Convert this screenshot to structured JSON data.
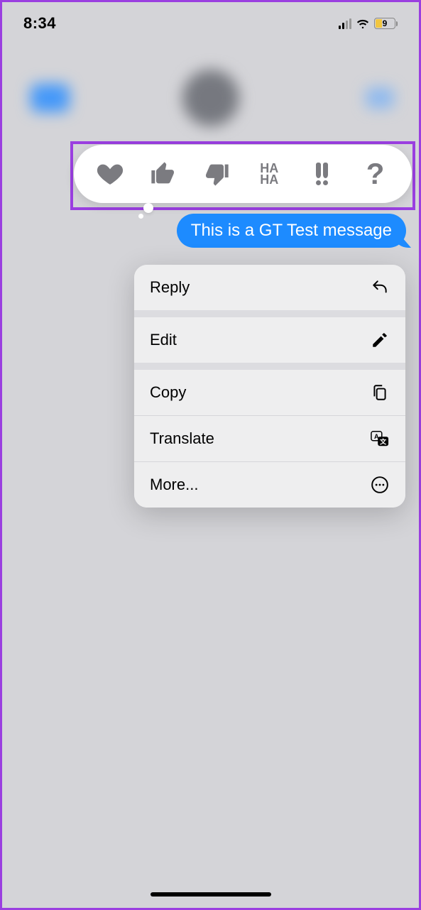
{
  "status": {
    "time": "8:34",
    "battery_percent": "9"
  },
  "tapback": {
    "reactions": [
      "heart",
      "thumbs-up",
      "thumbs-down",
      "haha",
      "exclaim",
      "question"
    ]
  },
  "message": {
    "text": "This is a GT Test message"
  },
  "menu": {
    "reply": "Reply",
    "edit": "Edit",
    "copy": "Copy",
    "translate": "Translate",
    "more": "More..."
  }
}
